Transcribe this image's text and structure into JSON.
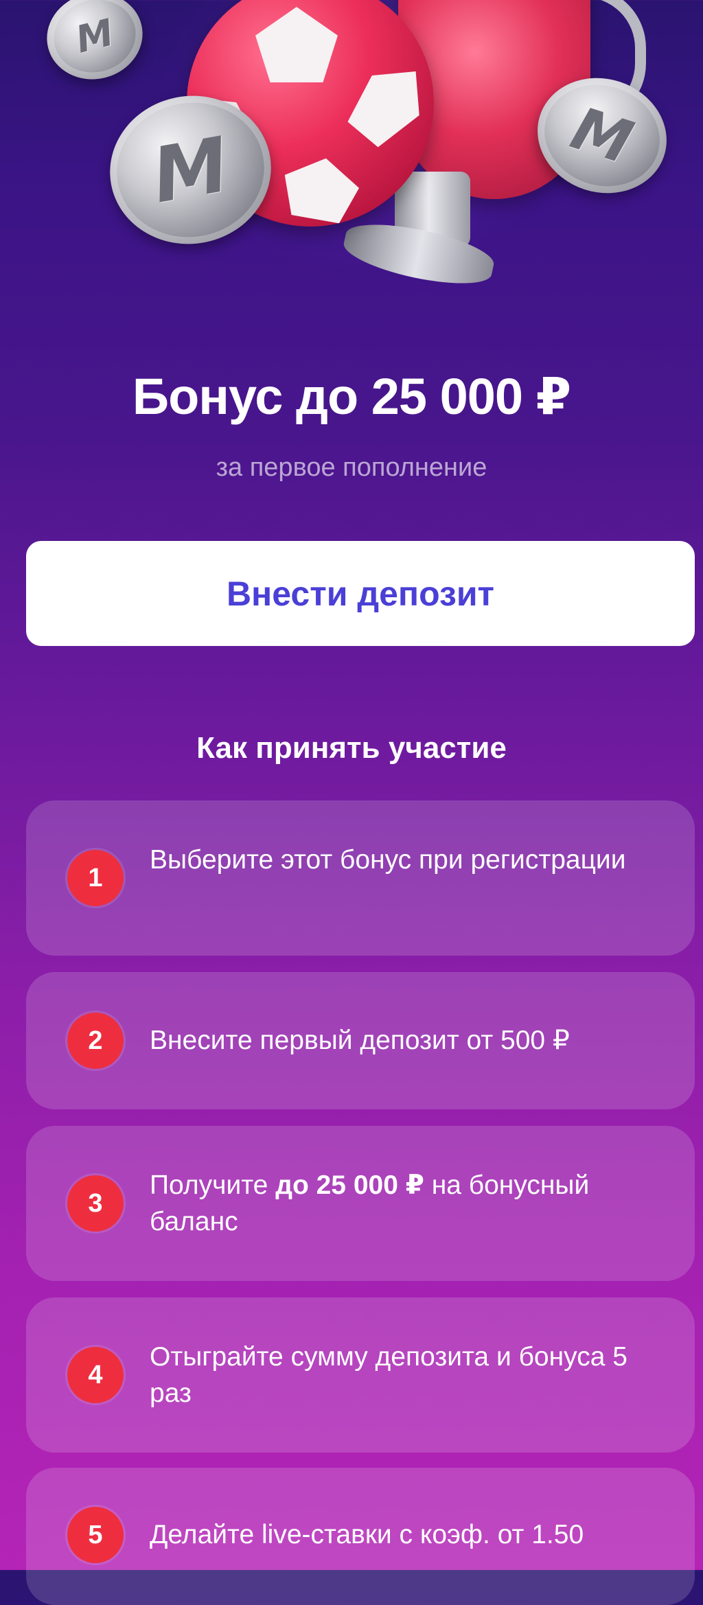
{
  "hero": {
    "coin_mark": "M"
  },
  "promo": {
    "title": "Бонус до 25 000 ₽",
    "subtitle": "за первое пополнение",
    "deposit_button": "Внести депозит"
  },
  "how_to": {
    "title": "Как принять участие",
    "steps": [
      {
        "number": "1",
        "text": "Выберите этот бонус при регистрации"
      },
      {
        "number": "2",
        "text": "Внесите первый депозит от 500 ₽"
      },
      {
        "number": "3",
        "text_before": "Получите ",
        "text_bold": "до 25 000 ₽",
        "text_after": " на бонусный баланс"
      },
      {
        "number": "4",
        "text": "Отыграйте сумму депозита и бонуса 5 раз"
      },
      {
        "number": "5",
        "text": "Делайте live-ставки с коэф. от 1.50"
      }
    ]
  },
  "colors": {
    "background_top": "#2a1470",
    "background_bottom": "#b424b6",
    "button_text": "#4a3fd6",
    "step_badge": "#ee2e3f"
  }
}
